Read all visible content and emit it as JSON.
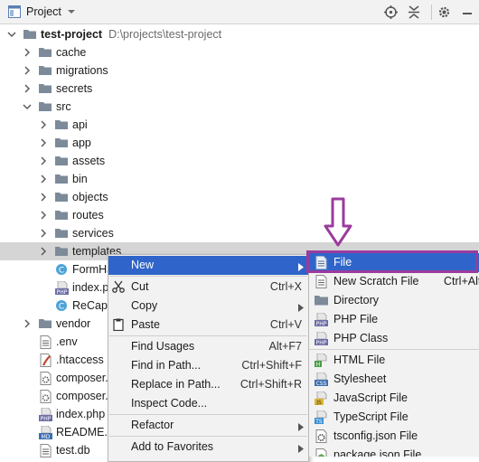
{
  "toolbar": {
    "title": "Project",
    "icons": [
      "project-view-icon",
      "dropdown-icon",
      "locate-icon",
      "collapse-all-icon",
      "gear-icon",
      "hide-icon"
    ]
  },
  "tree": {
    "root": {
      "name": "test-project",
      "path": "D:\\projects\\test-project"
    },
    "items": [
      {
        "label": "cache",
        "kind": "folder"
      },
      {
        "label": "migrations",
        "kind": "folder"
      },
      {
        "label": "secrets",
        "kind": "folder"
      },
      {
        "label": "src",
        "kind": "folder"
      },
      {
        "label": "api",
        "kind": "folder"
      },
      {
        "label": "app",
        "kind": "folder"
      },
      {
        "label": "assets",
        "kind": "folder"
      },
      {
        "label": "bin",
        "kind": "folder"
      },
      {
        "label": "objects",
        "kind": "folder"
      },
      {
        "label": "routes",
        "kind": "folder"
      },
      {
        "label": "services",
        "kind": "folder"
      },
      {
        "label": "templates",
        "kind": "folder"
      },
      {
        "label": "FormHa",
        "kind": "class"
      },
      {
        "label": "index.p",
        "kind": "php"
      },
      {
        "label": "ReCapt",
        "kind": "class"
      },
      {
        "label": "vendor",
        "kind": "folder"
      },
      {
        "label": ".env",
        "kind": "text"
      },
      {
        "label": ".htaccess",
        "kind": "htaccess"
      },
      {
        "label": "composer.",
        "kind": "config"
      },
      {
        "label": "composer.",
        "kind": "config"
      },
      {
        "label": "index.php",
        "kind": "php"
      },
      {
        "label": "README.m",
        "kind": "md"
      },
      {
        "label": "test.db",
        "kind": "db"
      }
    ]
  },
  "context_menu": {
    "items": [
      {
        "label": "New",
        "shortcut": ""
      },
      {
        "label": "Cut",
        "shortcut": "Ctrl+X"
      },
      {
        "label": "Copy",
        "shortcut": ""
      },
      {
        "label": "Paste",
        "shortcut": "Ctrl+V"
      },
      {
        "label": "Find Usages",
        "shortcut": "Alt+F7"
      },
      {
        "label": "Find in Path...",
        "shortcut": "Ctrl+Shift+F"
      },
      {
        "label": "Replace in Path...",
        "shortcut": "Ctrl+Shift+R"
      },
      {
        "label": "Inspect Code...",
        "shortcut": ""
      },
      {
        "label": "Refactor",
        "shortcut": ""
      },
      {
        "label": "Add to Favorites",
        "shortcut": ""
      }
    ]
  },
  "submenu": {
    "items": [
      {
        "label": "File",
        "shortcut": ""
      },
      {
        "label": "New Scratch File",
        "shortcut": "Ctrl+Alt"
      },
      {
        "label": "Directory",
        "shortcut": ""
      },
      {
        "label": "PHP File",
        "shortcut": ""
      },
      {
        "label": "PHP Class",
        "shortcut": ""
      },
      {
        "label": "HTML File",
        "shortcut": ""
      },
      {
        "label": "Stylesheet",
        "shortcut": ""
      },
      {
        "label": "JavaScript File",
        "shortcut": ""
      },
      {
        "label": "TypeScript File",
        "shortcut": ""
      },
      {
        "label": "tsconfig.json File",
        "shortcut": ""
      },
      {
        "label": "package.json File",
        "shortcut": ""
      }
    ]
  },
  "colors": {
    "selection": "#2f65ca",
    "highlight_box": "#9b3b9e",
    "folder": "#7c8a99",
    "row_selected": "#d5d5d5"
  }
}
